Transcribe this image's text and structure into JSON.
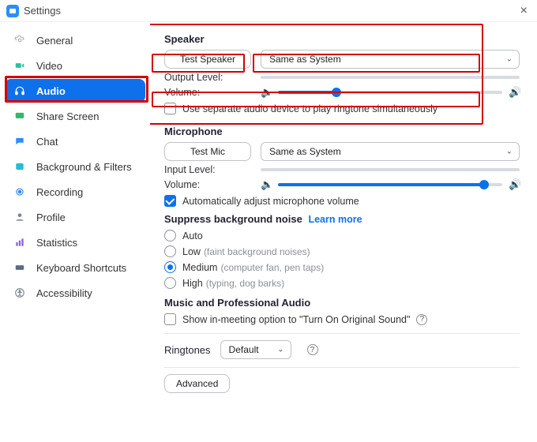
{
  "window": {
    "title": "Settings"
  },
  "sidebar": {
    "items": [
      {
        "label": "General"
      },
      {
        "label": "Video"
      },
      {
        "label": "Audio"
      },
      {
        "label": "Share Screen"
      },
      {
        "label": "Chat"
      },
      {
        "label": "Background & Filters"
      },
      {
        "label": "Recording"
      },
      {
        "label": "Profile"
      },
      {
        "label": "Statistics"
      },
      {
        "label": "Keyboard Shortcuts"
      },
      {
        "label": "Accessibility"
      }
    ]
  },
  "speaker": {
    "title": "Speaker",
    "test_label": "Test Speaker",
    "device": "Same as System",
    "output_level_label": "Output Level:",
    "volume_label": "Volume:",
    "separate_device_label": "Use separate audio device to play ringtone simultaneously"
  },
  "mic": {
    "title": "Microphone",
    "test_label": "Test Mic",
    "device": "Same as System",
    "input_level_label": "Input Level:",
    "volume_label": "Volume:",
    "auto_adjust_label": "Automatically adjust microphone volume"
  },
  "noise": {
    "title": "Suppress background noise",
    "learn_more": "Learn more",
    "auto": "Auto",
    "low": "Low",
    "low_hint": "(faint background noises)",
    "medium": "Medium",
    "medium_hint": "(computer fan, pen taps)",
    "high": "High",
    "high_hint": "(typing, dog barks)"
  },
  "pro_audio": {
    "title": "Music and Professional Audio",
    "original_sound_label": "Show in-meeting option to \"Turn On Original Sound\""
  },
  "ringtones": {
    "label": "Ringtones",
    "value": "Default"
  },
  "advanced": {
    "label": "Advanced"
  },
  "slider": {
    "speaker_volume_pct": "26",
    "mic_volume_pct": "92"
  }
}
